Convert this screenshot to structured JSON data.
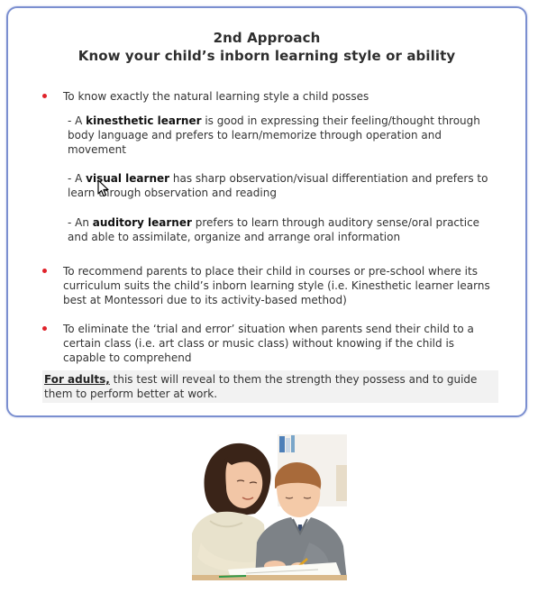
{
  "slide": {
    "title_line1": "2nd Approach",
    "title_line2": "Know your child’s inborn learning style or ability",
    "bullets": [
      "To know exactly the natural learning style a child posses",
      "To recommend parents to place their child in courses or pre-school where its curriculum suits the child’s inborn learning style (i.e. Kinesthetic learner learns best at Montessori due to its activity-based method)",
      "To eliminate the ‘trial and error’ situation when parents send their child to a certain class (i.e. art class or music class) without knowing if the child is capable to comprehend"
    ],
    "sub_items": [
      {
        "prefix": "- A ",
        "term": "kinesthetic learner",
        "text": " is good in expressing their feeling/thought through body language and prefers to learn/memorize through operation and movement"
      },
      {
        "prefix": "- A ",
        "term": "visual learner",
        "text": " has sharp observation/visual differentiation and prefers to learn through observation and reading"
      },
      {
        "prefix": "- An ",
        "term": "auditory learner",
        "text": " prefers to learn through auditory sense/oral practice and able to assimilate, organize and arrange oral information"
      }
    ],
    "adults_label": "For adults,",
    "adults_text": " this test will reveal to them the strength they possess and to guide them to perform better at work."
  },
  "colors": {
    "border": "#7b8fd0",
    "bullet": "#e0222a"
  },
  "icons": {
    "cursor": "mouse-pointer-icon",
    "bullet": "red-dot-bullet-icon"
  }
}
